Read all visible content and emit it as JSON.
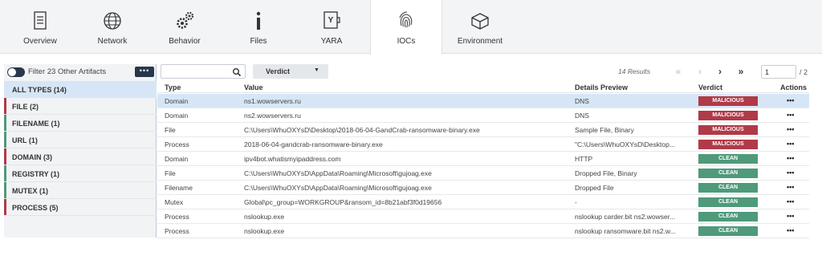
{
  "tabs": [
    {
      "label": "Overview",
      "icon": "document-icon"
    },
    {
      "label": "Network",
      "icon": "globe-icon"
    },
    {
      "label": "Behavior",
      "icon": "gears-icon"
    },
    {
      "label": "Files",
      "icon": "info-icon"
    },
    {
      "label": "YARA",
      "icon": "yara-icon"
    },
    {
      "label": "IOCs",
      "icon": "fingerprint-icon",
      "active": true
    },
    {
      "label": "Environment",
      "icon": "cube-icon"
    }
  ],
  "filter": {
    "label": "Filter 23 Other Artifacts",
    "more_label": "•••"
  },
  "categories": [
    {
      "label": "ALL TYPES (14)",
      "color": "#d6e6f6",
      "selected": true
    },
    {
      "label": "FILE (2)",
      "color": "#b03a48"
    },
    {
      "label": "FILENAME (1)",
      "color": "#4e9a7b"
    },
    {
      "label": "URL (1)",
      "color": "#4e9a7b"
    },
    {
      "label": "DOMAIN (3)",
      "color": "#b03a48"
    },
    {
      "label": "REGISTRY (1)",
      "color": "#4e9a7b"
    },
    {
      "label": "MUTEX (1)",
      "color": "#4e9a7b"
    },
    {
      "label": "PROCESS (5)",
      "color": "#b03a48"
    }
  ],
  "toolbar": {
    "search_placeholder": "",
    "verdict_label": "Verdict",
    "results_label": "14 Results",
    "page_value": "1",
    "page_total": "/ 2"
  },
  "columns": {
    "type": "Type",
    "value": "Value",
    "details": "Details Preview",
    "verdict": "Verdict",
    "actions": "Actions"
  },
  "rows": [
    {
      "type": "Domain",
      "value": "ns1.wowservers.ru",
      "details": "DNS",
      "verdict": "MALICIOUS",
      "selected": true
    },
    {
      "type": "Domain",
      "value": "ns2.wowservers.ru",
      "details": "DNS",
      "verdict": "MALICIOUS"
    },
    {
      "type": "File",
      "value": "C:\\Users\\WhuOXYsD\\Desktop\\2018-06-04-GandCrab-ransomware-binary.exe",
      "details": "Sample File, Binary",
      "verdict": "MALICIOUS"
    },
    {
      "type": "Process",
      "value": "2018-06-04-gandcrab-ransomware-binary.exe",
      "details": "\"C:\\Users\\WhuOXYsD\\Desktop...",
      "verdict": "MALICIOUS"
    },
    {
      "type": "Domain",
      "value": "ipv4bot.whatismyipaddress.com",
      "details": "HTTP",
      "verdict": "CLEAN"
    },
    {
      "type": "File",
      "value": "C:\\Users\\WhuOXYsD\\AppData\\Roaming\\Microsoft\\gujoag.exe",
      "details": "Dropped File, Binary",
      "verdict": "CLEAN"
    },
    {
      "type": "Filename",
      "value": "C:\\Users\\WhuOXYsD\\AppData\\Roaming\\Microsoft\\gujoag.exe",
      "details": "Dropped File",
      "verdict": "CLEAN"
    },
    {
      "type": "Mutex",
      "value": "Global\\pc_group=WORKGROUP&ransom_id=8b21abf3f0d19656",
      "details": "-",
      "verdict": "CLEAN"
    },
    {
      "type": "Process",
      "value": "nslookup.exe",
      "details": "nslookup carder.bit ns2.wowser...",
      "verdict": "CLEAN"
    },
    {
      "type": "Process",
      "value": "nslookup.exe",
      "details": "nslookup ransomware.bit ns2.w...",
      "verdict": "CLEAN"
    }
  ],
  "actions_label": "•••",
  "colors": {
    "malicious": "#b03a48",
    "clean": "#4e9a7b",
    "selection": "#d6e6f6",
    "dark": "#27384d"
  }
}
